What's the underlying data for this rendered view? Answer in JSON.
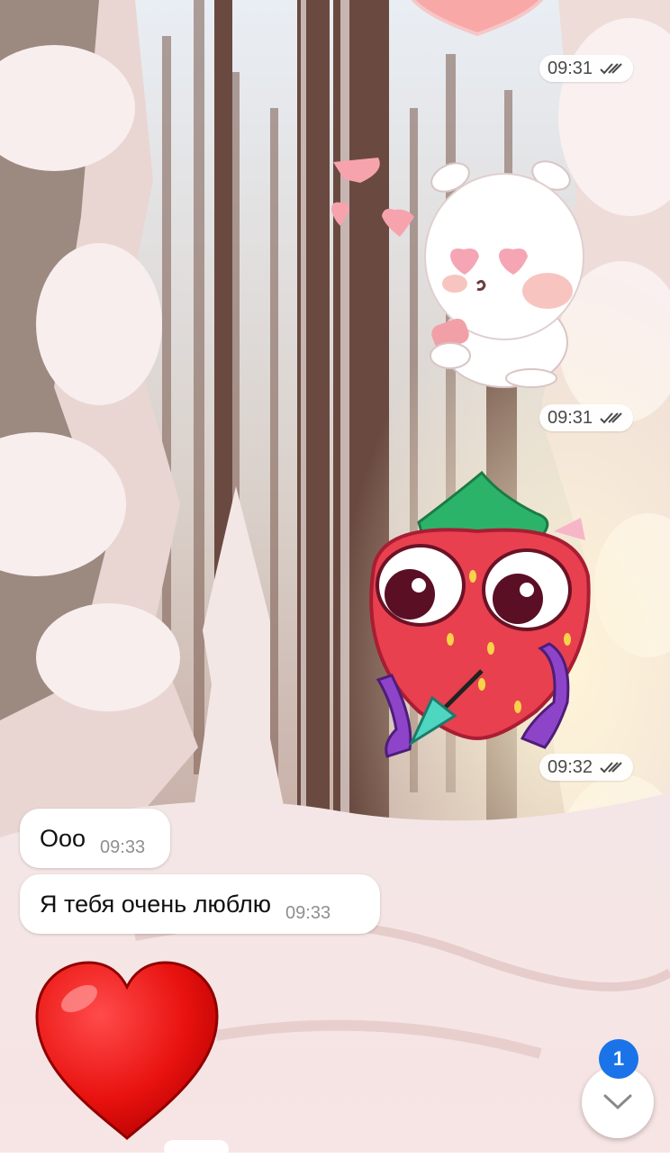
{
  "wallpaper": {
    "name": "snowy-forest-wallpaper",
    "sky": "#dfe7ef",
    "snow": "#f6e8ea"
  },
  "messages": [
    {
      "kind": "sticker",
      "sticker": "pink-heart-sticker",
      "direction": "outgoing",
      "time": "09:31",
      "status": "read"
    },
    {
      "kind": "sticker",
      "sticker": "bunny-in-love-sticker",
      "direction": "outgoing",
      "time": "09:31",
      "status": "read"
    },
    {
      "kind": "sticker",
      "sticker": "strawberry-with-arrow-sticker",
      "direction": "outgoing",
      "time": "09:32",
      "status": "read"
    },
    {
      "kind": "text",
      "direction": "incoming",
      "text": "Ооо",
      "time": "09:33"
    },
    {
      "kind": "text",
      "direction": "incoming",
      "text": "Я тебя очень люблю",
      "time": "09:33"
    },
    {
      "kind": "sticker",
      "sticker": "red-heart-sticker",
      "direction": "incoming"
    }
  ],
  "scroll_down": {
    "icon": "chevron-down-icon",
    "unread_count": "1",
    "badge_color": "#1a73e8"
  }
}
